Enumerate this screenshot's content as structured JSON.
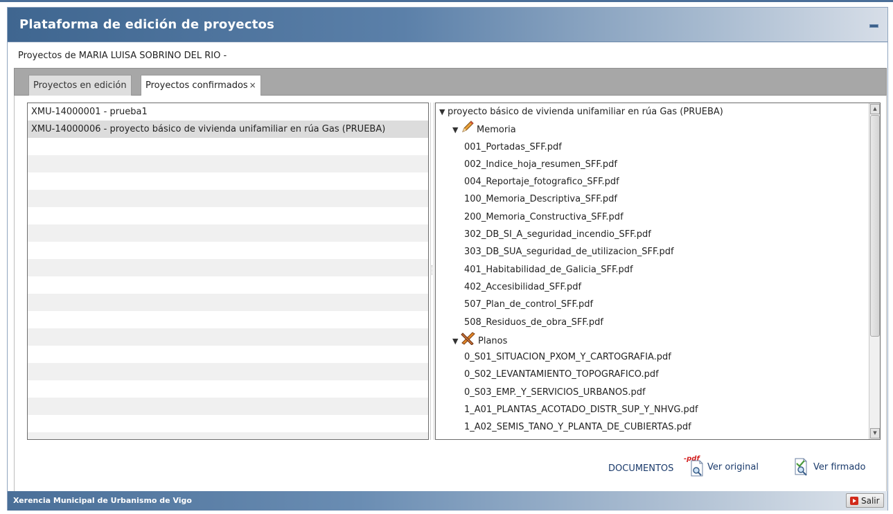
{
  "header": {
    "title": "Plataforma de edición de proyectos"
  },
  "subtitle": "Proyectos de MARIA LUISA SOBRINO DEL RIO -",
  "tabs": [
    {
      "label": "Proyectos en edición"
    },
    {
      "label": "Proyectos confirmados",
      "close": "×"
    }
  ],
  "projects": [
    "XMU-14000001 - prueba1",
    "XMU-14000006 - proyecto básico de vivienda unifamiliar en rúa Gas (PRUEBA)"
  ],
  "tree": {
    "root_label": "proyecto básico de vivienda unifamiliar en rúa Gas (PRUEBA)",
    "folders": [
      {
        "label": "Memoria",
        "icon": "pencil-icon",
        "files": [
          "001_Portadas_SFF.pdf",
          "002_Indice_hoja_resumen_SFF.pdf",
          "004_Reportaje_fotografico_SFF.pdf",
          "100_Memoria_Descriptiva_SFF.pdf",
          "200_Memoria_Constructiva_SFF.pdf",
          "302_DB_SI_A_seguridad_incendio_SFF.pdf",
          "303_DB_SUA_seguridad_de_utilizacion_SFF.pdf",
          "401_Habitabilidad_de_Galicia_SFF.pdf",
          "402_Accesibilidad_SFF.pdf",
          "507_Plan_de_control_SFF.pdf",
          "508_Residuos_de_obra_SFF.pdf"
        ]
      },
      {
        "label": "Planos",
        "icon": "drafting-tools-icon",
        "files": [
          "0_S01_SITUACION_PXOM_Y_CARTOGRAFIA.pdf",
          "0_S02_LEVANTAMIENTO_TOPOGRAFICO.pdf",
          "0_S03_EMP._Y_SERVICIOS_URBANOS.pdf",
          "1_A01_PLANTAS_ACOTADO_DISTR_SUP_Y_NHVG.pdf",
          "1_A02_SEMIS_TANO_Y_PLANTA_DE_CUBIERTAS.pdf"
        ]
      }
    ]
  },
  "documents": {
    "label": "DOCUMENTOS",
    "pdf_badge": "-pdf",
    "view_original": "Ver original",
    "view_signed": "Ver firmado"
  },
  "footer": {
    "title": "Xerencia Municipal de Urbanismo de Vigo",
    "exit_label": "Salir"
  },
  "colors": {
    "header_accent": "#3f6690",
    "selected_row": "#dcdcdc",
    "link_text": "#1a3a6b",
    "exit_red": "#d12a1a"
  }
}
